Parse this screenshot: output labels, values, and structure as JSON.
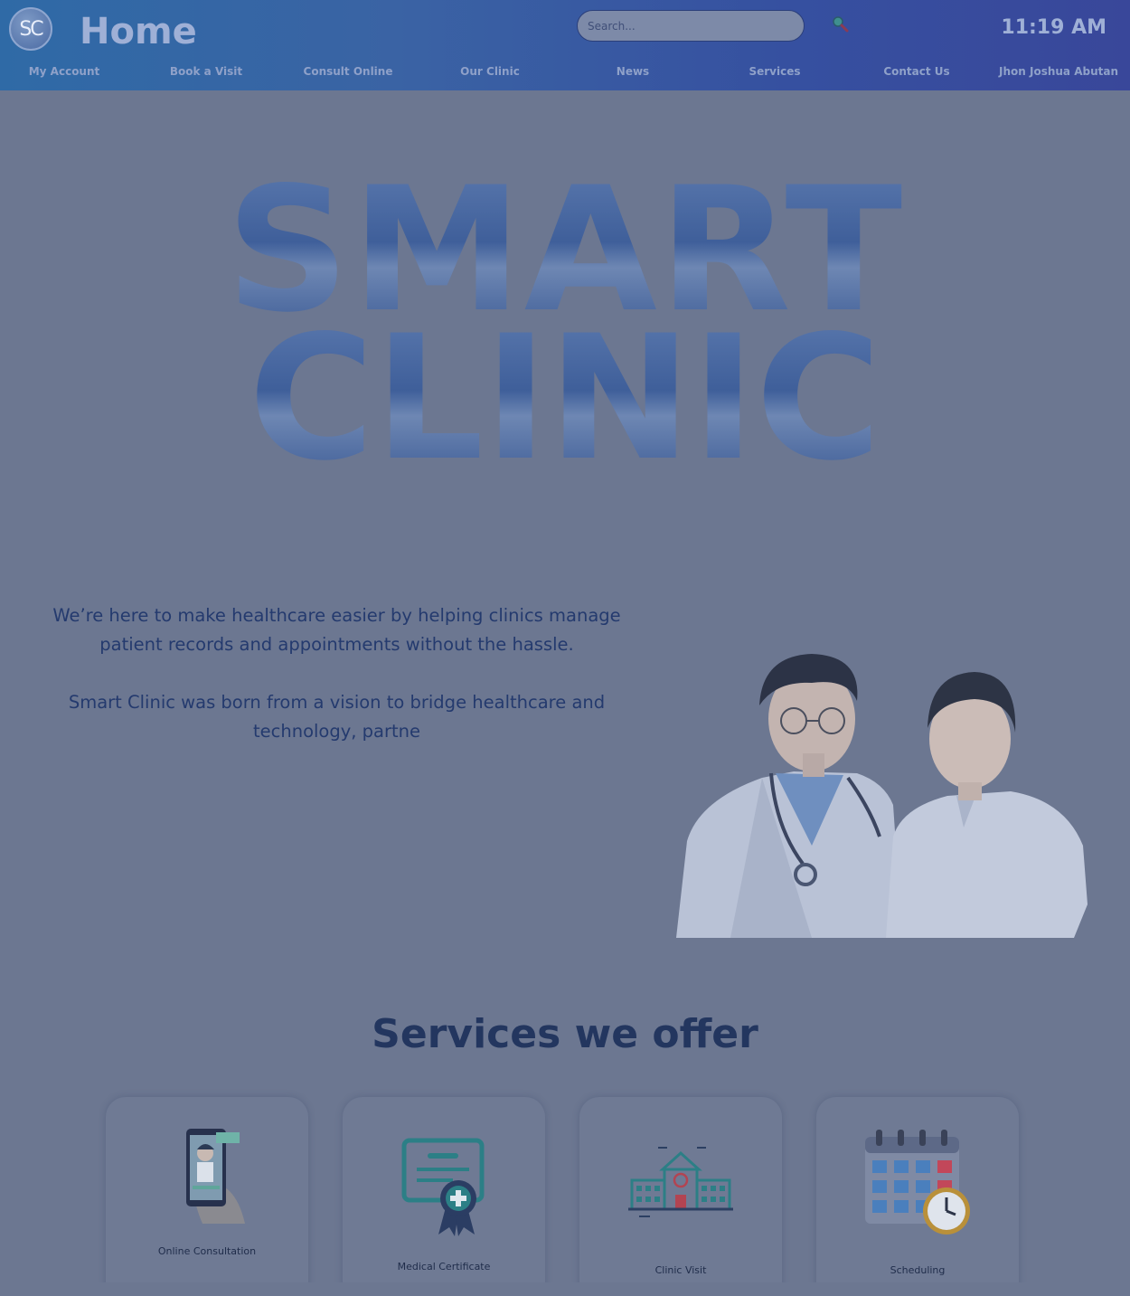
{
  "header": {
    "logo_text": "SC",
    "page_title": "Home",
    "search_placeholder": "Search...",
    "time": "11:19 AM"
  },
  "nav": {
    "items": [
      {
        "label": "My Account"
      },
      {
        "label": "Book a Visit"
      },
      {
        "label": "Consult Online"
      },
      {
        "label": "Our Clinic"
      },
      {
        "label": "News"
      },
      {
        "label": "Services"
      },
      {
        "label": "Contact Us"
      },
      {
        "label": "Jhon Joshua Abutan"
      }
    ]
  },
  "hero": {
    "line1": "SMART",
    "line2": "CLINIC"
  },
  "intro": {
    "paragraph1": "We’re here to make healthcare easier by helping clinics manage patient records and appointments without the hassle.",
    "paragraph2": "Smart Clinic was born from a vision to bridge healthcare and technology, partne"
  },
  "services": {
    "title": "Services we offer",
    "cards": [
      {
        "label": "Online Consultation",
        "icon": "phone-doctor-icon"
      },
      {
        "label": "Medical Certificate",
        "icon": "certificate-icon"
      },
      {
        "label": "Clinic Visit",
        "icon": "hospital-icon"
      },
      {
        "label": "Scheduling",
        "icon": "calendar-clock-icon"
      }
    ]
  },
  "colors": {
    "header_start": "#2f6aa6",
    "header_end": "#39479a",
    "overlay_bg": "#6c7791",
    "text_dark": "#243a6e"
  }
}
